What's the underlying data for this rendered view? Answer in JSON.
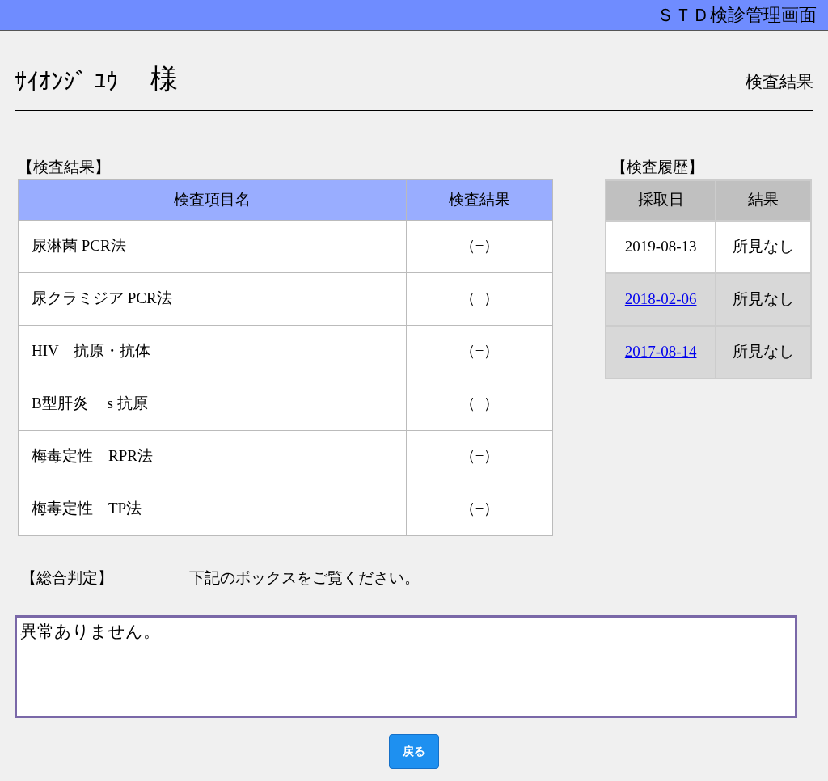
{
  "header": {
    "title": "ＳＴＤ検診管理画面"
  },
  "patient": {
    "name": "ｻｲｵﾝｼﾞ ﾕｳ",
    "honorific": "様",
    "page_label": "検査結果"
  },
  "results": {
    "heading": "【検査結果】",
    "columns": [
      "検査項目名",
      "検査結果"
    ],
    "rows": [
      {
        "item": "尿淋菌 PCR法",
        "result": "（−）"
      },
      {
        "item": "尿クラミジア PCR法",
        "result": "（−）"
      },
      {
        "item": "HIV　抗原・抗体",
        "result": "（−）"
      },
      {
        "item": "B型肝炎　 s 抗原",
        "result": "（−）"
      },
      {
        "item": "梅毒定性　RPR法",
        "result": "（−）"
      },
      {
        "item": "梅毒定性　TP法",
        "result": "（−）"
      }
    ]
  },
  "history": {
    "heading": "【検査履歴】",
    "columns": [
      "採取日",
      "結果"
    ],
    "rows": [
      {
        "date": "2019-08-13",
        "result": "所見なし",
        "selected": true
      },
      {
        "date": "2018-02-06",
        "result": "所見なし",
        "selected": false
      },
      {
        "date": "2017-08-14",
        "result": "所見なし",
        "selected": false
      }
    ]
  },
  "judgement": {
    "heading": "【総合判定】",
    "note": "下記のボックスをご覧ください。",
    "value": "異常ありません。"
  },
  "buttons": [
    {
      "label": "戻る"
    }
  ]
}
